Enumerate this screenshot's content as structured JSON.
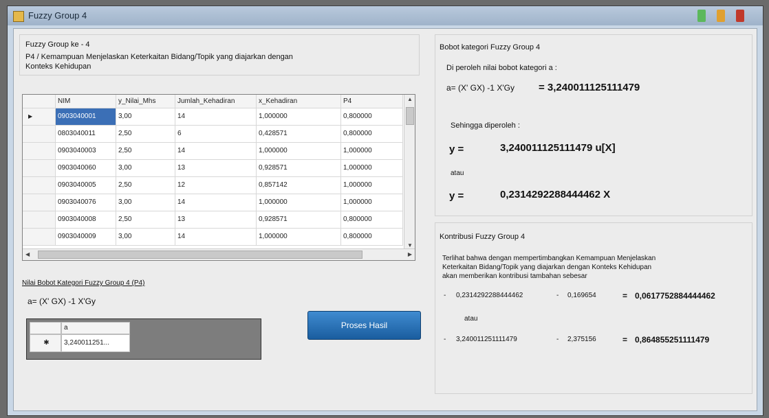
{
  "window": {
    "title": "Fuzzy Group 4"
  },
  "left": {
    "heading": "Fuzzy Group ke - 4",
    "description_line1": "P4 / Kemampuan Menjelaskan Keterkaitan Bidang/Topik yang diajarkan dengan",
    "description_line2": "Konteks Kehidupan",
    "grid": {
      "columns": [
        "NIM",
        "y_Nilai_Mhs",
        "Jumlah_Kehadiran",
        "x_Kehadiran",
        "P4"
      ],
      "rows": [
        [
          "0903040001",
          "3,00",
          "14",
          "1,000000",
          "0,800000"
        ],
        [
          "0803040011",
          "2,50",
          "6",
          "0,428571",
          "0,800000"
        ],
        [
          "0903040003",
          "2,50",
          "14",
          "1,000000",
          "1,000000"
        ],
        [
          "0903040060",
          "3,00",
          "13",
          "0,928571",
          "1,000000"
        ],
        [
          "0903040005",
          "2,50",
          "12",
          "0,857142",
          "1,000000"
        ],
        [
          "0903040076",
          "3,00",
          "14",
          "1,000000",
          "1,000000"
        ],
        [
          "0903040008",
          "2,50",
          "13",
          "0,928571",
          "0,800000"
        ],
        [
          "0903040009",
          "3,00",
          "14",
          "1,000000",
          "0,800000"
        ]
      ]
    },
    "weights_label": "Nilai Bobot Kategori Fuzzy Group 4 (P4)",
    "formula": "a= (X' GX) -1 X'Gy",
    "small_grid": {
      "header": "a",
      "value": "3,240011251..."
    },
    "process_button": "Proses Hasil"
  },
  "right": {
    "bobot": {
      "title": "Bobot kategori Fuzzy Group 4",
      "obtained_label": "Di peroleh nilai bobot kategori a :",
      "formula": "a= (X' GX) -1 X'Gy",
      "formula_value": "= 3,240011125111479",
      "so_label": "Sehingga diperoleh :",
      "eq1_lhs": "y =",
      "eq1_rhs": "3,240011125111479 u[X]",
      "or1": "atau",
      "eq2_lhs": "y =",
      "eq2_rhs": "0,2314292288444462  X"
    },
    "kontribusi": {
      "title": "Kontribusi Fuzzy Group 4",
      "para1": "Terlihat bahwa dengan mempertimbangkan Kemampuan Menjelaskan",
      "para2": "Keterkaitan Bidang/Topik yang diajarkan dengan Konteks Kehidupan",
      "para3": "akan memberikan kontribusi tambahan sebesar",
      "r1_dash": "-",
      "r1_a": "0,2314292288444462",
      "r1_op": "-",
      "r1_b": "0,169654",
      "r1_eq": "=",
      "r1_result": "0,0617752884444462",
      "or2": "atau",
      "r2_dash": "-",
      "r2_a": "3,240011251111479",
      "r2_op": "-",
      "r2_b": "2,375156",
      "r2_eq": "=",
      "r2_result": "0,864855251111479"
    }
  },
  "colors": {
    "accent": "#1a5d9f",
    "selection": "#3b6fb6",
    "window_min": "#5cb85c",
    "window_max": "#e0a030",
    "window_close": "#c0392b"
  }
}
